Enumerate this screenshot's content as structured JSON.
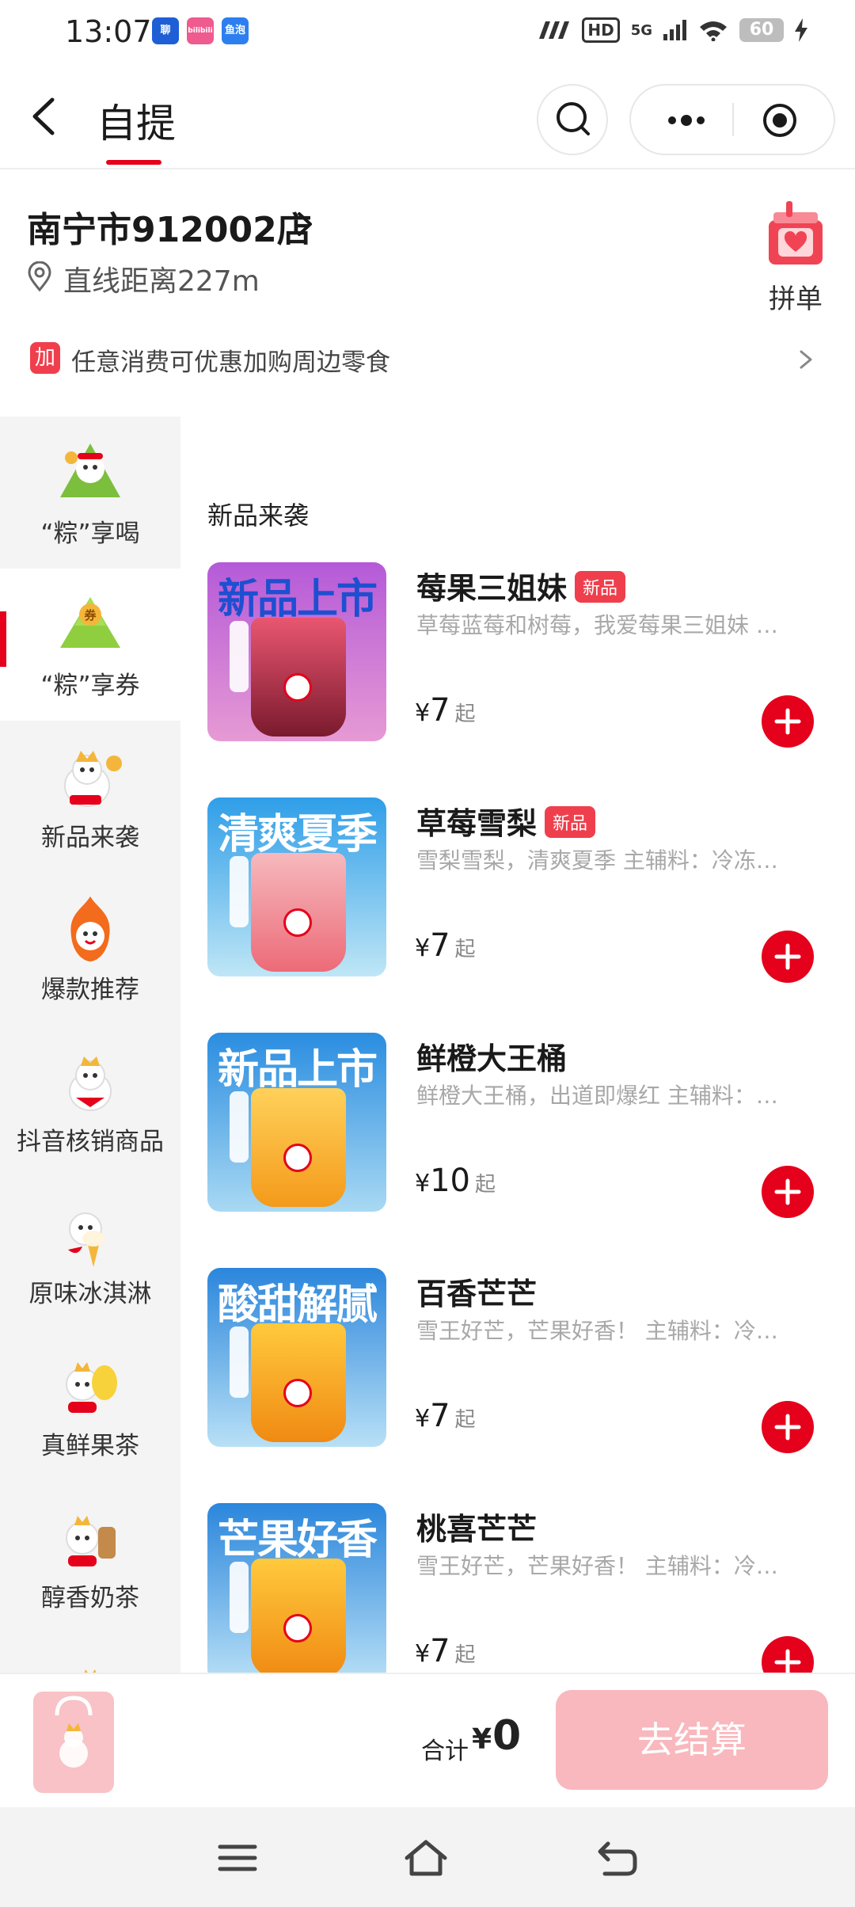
{
  "status_bar": {
    "time": "13:07",
    "apps": [
      "聊",
      "bilibili",
      "鱼泡"
    ],
    "signal_text": "5G",
    "hd": "HD",
    "battery": "60"
  },
  "nav": {
    "title": "自提"
  },
  "store": {
    "name": "南宁市912002店",
    "distance": "直线距离227m",
    "group_order_label": "拼单"
  },
  "promo": {
    "badge": "加",
    "text": "任意消费可优惠加购周边零食"
  },
  "sidebar": {
    "items": [
      {
        "label": "“粽”享喝"
      },
      {
        "label": "“粽”享券",
        "active": true
      },
      {
        "label": "新品来袭"
      },
      {
        "label": "爆款推荐"
      },
      {
        "label": "抖音核销商品"
      },
      {
        "label": "原味冰淇淋"
      },
      {
        "label": "真鲜果茶"
      },
      {
        "label": "醇香奶茶"
      }
    ]
  },
  "section": {
    "title": "新品来袭"
  },
  "products": [
    {
      "name": "莓果三姐妹",
      "badge": "新品",
      "desc": "草莓蓝莓和树莓，我爱莓果三姐妹 …",
      "currency": "¥",
      "price": "7",
      "suffix": "起",
      "thumb_text": "新品上市"
    },
    {
      "name": "草莓雪梨",
      "badge": "新品",
      "desc": "雪梨雪梨，清爽夏季 主辅料：冷冻…",
      "currency": "¥",
      "price": "7",
      "suffix": "起",
      "thumb_text": "清爽夏季"
    },
    {
      "name": "鲜橙大王桶",
      "badge": "",
      "desc": "鲜橙大王桶，出道即爆红 主辅料：…",
      "currency": "¥",
      "price": "10",
      "suffix": "起",
      "thumb_text": "新品上市"
    },
    {
      "name": "百香芒芒",
      "badge": "",
      "desc": "雪王好芒，芒果好香！ 主辅料：冷…",
      "currency": "¥",
      "price": "7",
      "suffix": "起",
      "thumb_text": "酸甜解腻"
    },
    {
      "name": "桃喜芒芒",
      "badge": "",
      "desc": "雪王好芒，芒果好香！ 主辅料：冷…",
      "currency": "¥",
      "price": "7",
      "suffix": "起",
      "thumb_text": "芒果好香"
    }
  ],
  "cart": {
    "total_label": "合计",
    "currency": "¥",
    "total_value": "0",
    "checkout_label": "去结算"
  },
  "colors": {
    "brand_red": "#e5001b",
    "checkout_disabled": "#f8b8bd"
  }
}
